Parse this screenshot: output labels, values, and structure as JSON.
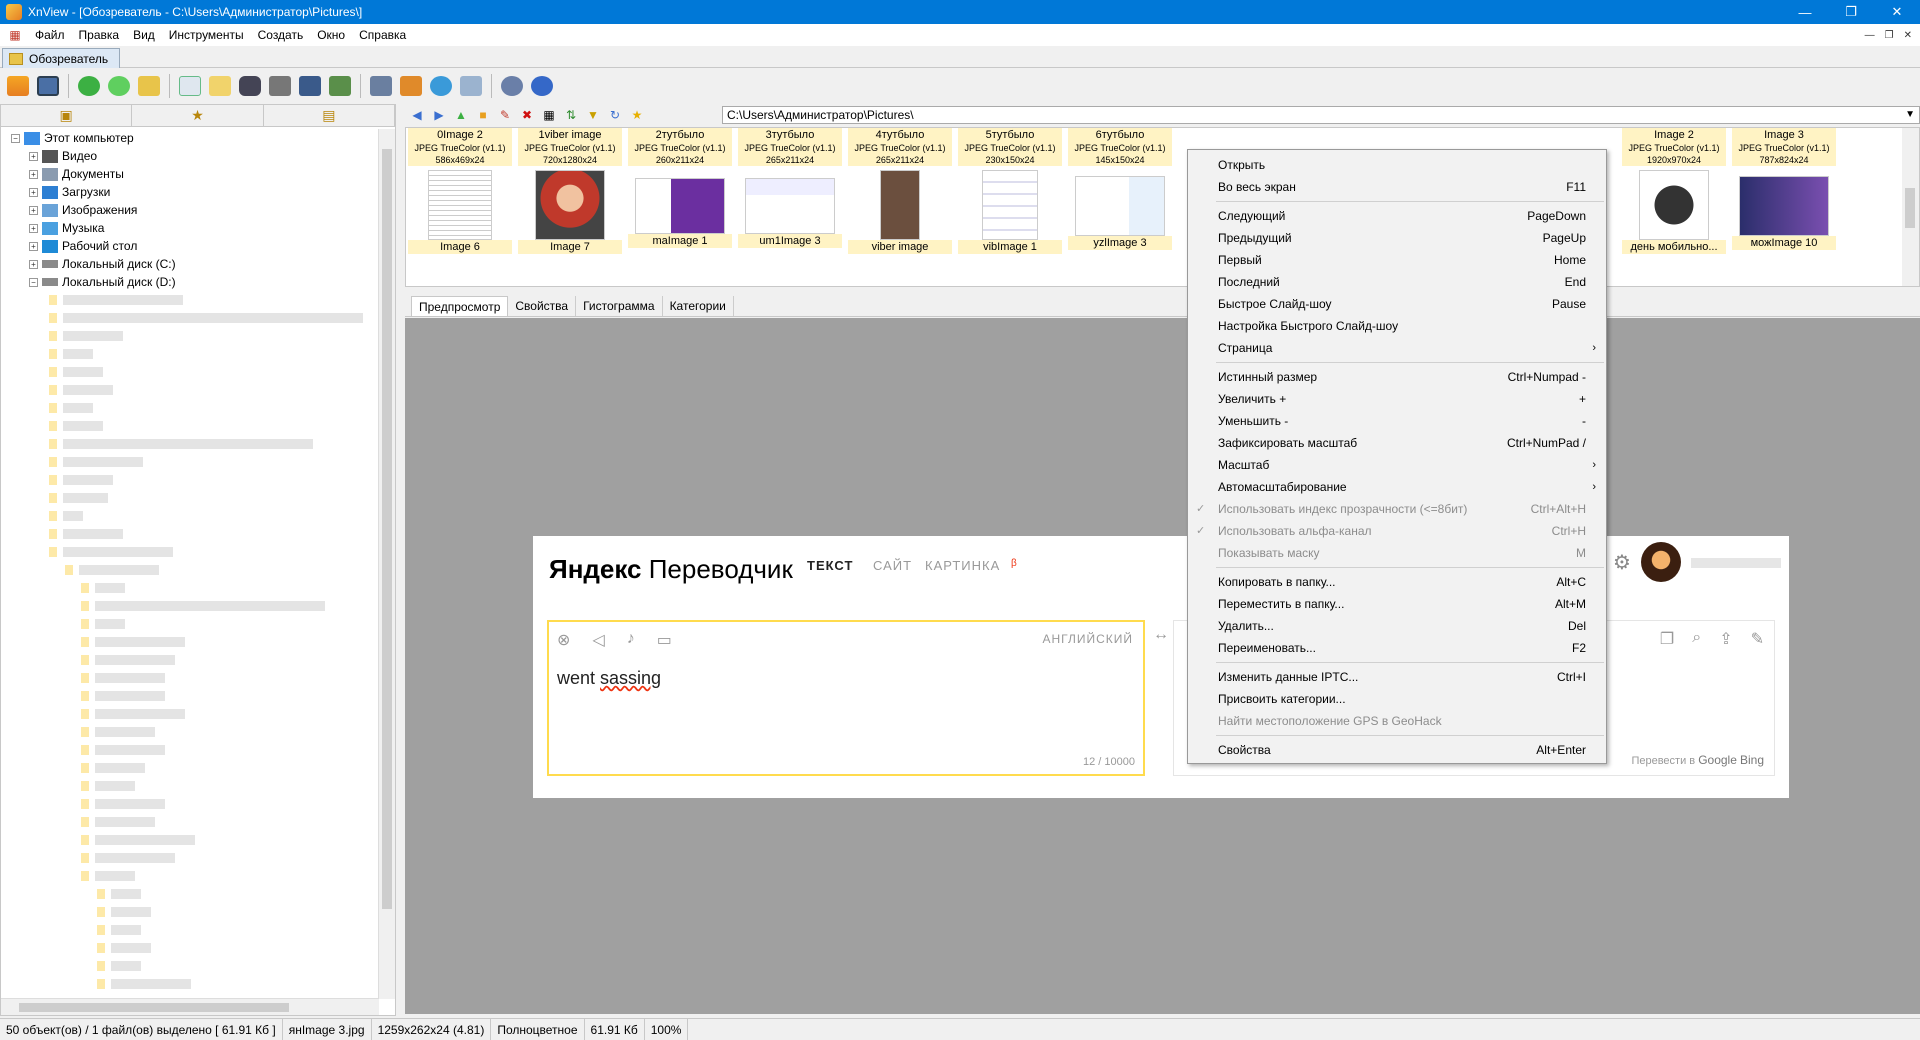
{
  "window": {
    "title": "XnView - [Обозреватель - C:\\Users\\Администратор\\Pictures\\]",
    "min": "—",
    "max": "❐",
    "close": "✕"
  },
  "menu": [
    "Файл",
    "Правка",
    "Вид",
    "Инструменты",
    "Создать",
    "Окно",
    "Справка"
  ],
  "tab": {
    "label": "Обозреватель"
  },
  "address": "C:\\Users\\Администратор\\Pictures\\",
  "tree": {
    "root": "Этот компьютер",
    "items": [
      "Видео",
      "Документы",
      "Загрузки",
      "Изображения",
      "Музыка",
      "Рабочий стол",
      "Локальный диск (C:)",
      "Локальный диск (D:)"
    ]
  },
  "thumbs_row1": [
    {
      "name": "0Image 2",
      "type": "JPEG TrueColor (v1.1)",
      "size": "586x469x24"
    },
    {
      "name": "1viber image",
      "type": "JPEG TrueColor (v1.1)",
      "size": "720x1280x24"
    },
    {
      "name": "2тутбыло",
      "type": "JPEG TrueColor (v1.1)",
      "size": "260x211x24"
    },
    {
      "name": "3тутбыло",
      "type": "JPEG TrueColor (v1.1)",
      "size": "265x211x24"
    },
    {
      "name": "4тутбыло",
      "type": "JPEG TrueColor (v1.1)",
      "size": "265x211x24"
    },
    {
      "name": "5тутбыло",
      "type": "JPEG TrueColor (v1.1)",
      "size": "230x150x24"
    },
    {
      "name": "6тутбыло",
      "type": "JPEG TrueColor (v1.1)",
      "size": "145x150x24"
    },
    {
      "name": "Image 2",
      "type": "JPEG TrueColor (v1.1)",
      "size": "1920x970x24"
    },
    {
      "name": "Image 3",
      "type": "JPEG TrueColor (v1.1)",
      "size": "787x824x24"
    }
  ],
  "thumbs_row2": [
    "Image 6",
    "Image 7",
    "maImage 1",
    "um1Image 3",
    "viber image",
    "vibImage 1",
    "yzlImage 3",
    "день мобильно...",
    "можImage 10"
  ],
  "preview_tabs": [
    "Предпросмотр",
    "Свойства",
    "Гистограмма",
    "Категории"
  ],
  "yandex": {
    "logo_a": "Яндекс",
    "logo_b": "Переводчик",
    "nav": [
      "ТЕКСТ",
      "САЙТ",
      "КАРТИНКА"
    ],
    "beta": "β",
    "lang": "АНГЛИЙСКИЙ",
    "text_a": "went ",
    "text_b": "sassing",
    "count": "12 / 10000",
    "via": "Перевести в",
    "via_google": "Google",
    "via_bing": "Bing"
  },
  "context_menu": [
    {
      "label": "Открыть",
      "shortcut": ""
    },
    {
      "label": "Во весь экран",
      "shortcut": "F11"
    },
    {
      "sep": true
    },
    {
      "label": "Следующий",
      "shortcut": "PageDown"
    },
    {
      "label": "Предыдущий",
      "shortcut": "PageUp"
    },
    {
      "label": "Первый",
      "shortcut": "Home"
    },
    {
      "label": "Последний",
      "shortcut": "End"
    },
    {
      "label": "Быстрое Слайд-шоу",
      "shortcut": "Pause"
    },
    {
      "label": "Настройка Быстрого Слайд-шоу",
      "shortcut": ""
    },
    {
      "label": "Страница",
      "shortcut": "",
      "submenu": true
    },
    {
      "sep": true
    },
    {
      "label": "Истинный размер",
      "shortcut": "Ctrl+Numpad -"
    },
    {
      "label": "Увеличить +",
      "shortcut": "+"
    },
    {
      "label": "Уменьшить -",
      "shortcut": "-"
    },
    {
      "label": "Зафиксировать масштаб",
      "shortcut": "Ctrl+NumPad /"
    },
    {
      "label": "Масштаб",
      "shortcut": "",
      "submenu": true
    },
    {
      "label": "Автомасштабирование",
      "shortcut": "",
      "submenu": true
    },
    {
      "label": "Использовать индекс прозрачности (<=8бит)",
      "shortcut": "Ctrl+Alt+H",
      "disabled": true,
      "check": true
    },
    {
      "label": "Использовать альфа-канал",
      "shortcut": "Ctrl+H",
      "disabled": true,
      "check": true
    },
    {
      "label": "Показывать маску",
      "shortcut": "M",
      "disabled": true
    },
    {
      "sep": true
    },
    {
      "label": "Копировать в папку...",
      "shortcut": "Alt+C"
    },
    {
      "label": "Переместить в папку...",
      "shortcut": "Alt+M"
    },
    {
      "label": "Удалить...",
      "shortcut": "Del"
    },
    {
      "label": "Переименовать...",
      "shortcut": "F2"
    },
    {
      "sep": true
    },
    {
      "label": "Изменить данные IPTC...",
      "shortcut": "Ctrl+I"
    },
    {
      "label": "Присвоить категории...",
      "shortcut": ""
    },
    {
      "label": "Найти местоположение GPS в GeoHack",
      "shortcut": "",
      "disabled": true
    },
    {
      "sep": true
    },
    {
      "label": "Свойства",
      "shortcut": "Alt+Enter"
    }
  ],
  "status": [
    "50 объект(ов) / 1 файл(ов) выделено [ 61.91 Кб ]",
    "янImage 3.jpg",
    "1259x262x24 (4.81)",
    "Полноцветное",
    "61.91 Кб",
    "100%"
  ]
}
